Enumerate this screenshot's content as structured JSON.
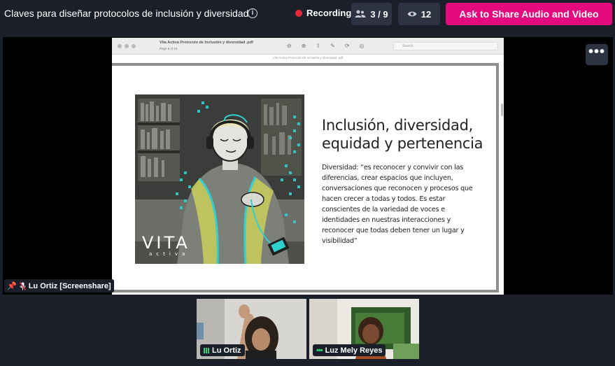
{
  "header": {
    "title": "Claves para diseñar protocolos de inclusión y diversidad",
    "info_icon": "i",
    "recording_label": "Recording",
    "participants_count": "3 / 9",
    "viewers_count": "12",
    "share_button_label": "Ask to Share Audio and Video",
    "accent_color": "#e5097f",
    "recording_color": "#e8293b"
  },
  "stage": {
    "more_label": "•••",
    "presenter_tag": "Lu Ortiz [Screenshare]"
  },
  "pdf_viewer": {
    "title": "Vita Activa Protocolo de Inclusión y diversidad .pdf",
    "page_indicator": "Page 6 of 16",
    "search_placeholder": "Search",
    "subtitle": "Vita Activa Protocolo de Inclusión y diversidad .pdf"
  },
  "slide": {
    "heading": "Inclusión, diversidad, equidad y pertenencia",
    "body": "Diversidad: “es reconocer y convivir con las diferencias, crear espacios que incluyen, conversaciones que reconocen y procesos que hacen crecer a todas y todos.  Es estar conscientes de la variedad de voces e identidades en nuestras interacciones y reconocer que todas deben tener un lugar y visibilidad”",
    "logo_text": "VITA",
    "logo_subtext": "activa"
  },
  "participants": [
    {
      "name": "Lu Ortiz"
    },
    {
      "name": "Luz Mely Reyes"
    }
  ]
}
